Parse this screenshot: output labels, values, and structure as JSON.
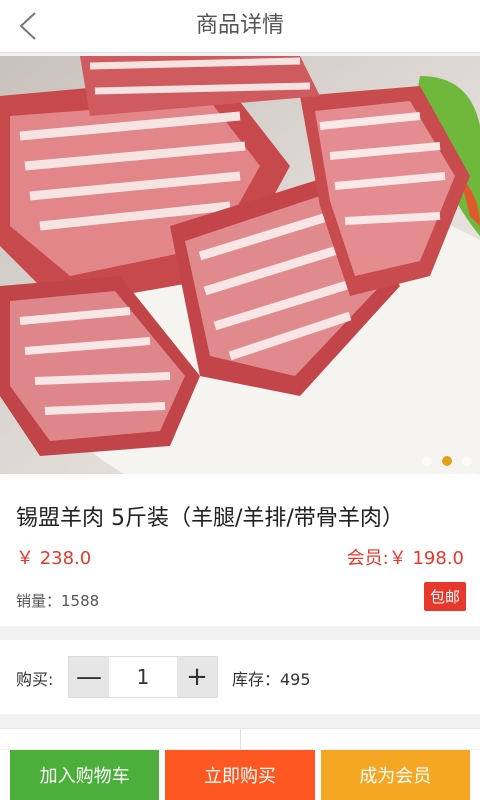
{
  "header": {
    "title": "商品详情"
  },
  "product": {
    "name": "锡盟羊肉 5斤装（羊腿/羊排/带骨羊肉）",
    "price": "￥ 238.0",
    "member_price": "会员:￥ 198.0",
    "sales": "销量：1588",
    "free_shipping": "包邮"
  },
  "quantity": {
    "label": "购买:",
    "minus": "—",
    "value": "1",
    "plus": "+",
    "stock": "库存：495"
  },
  "actions": {
    "add_to_cart": "加入购物车",
    "buy_now": "立即购买",
    "become_member": "成为会员"
  },
  "carousel": {
    "total": 3,
    "active_index": 1
  },
  "colors": {
    "price_red": "#e8372c",
    "cart_green": "#4caf3b",
    "buy_orange": "#ff5722",
    "member_gold": "#f5a623",
    "active_dot": "#e0a11b"
  },
  "icons": {
    "back": "chevron-left-icon"
  }
}
